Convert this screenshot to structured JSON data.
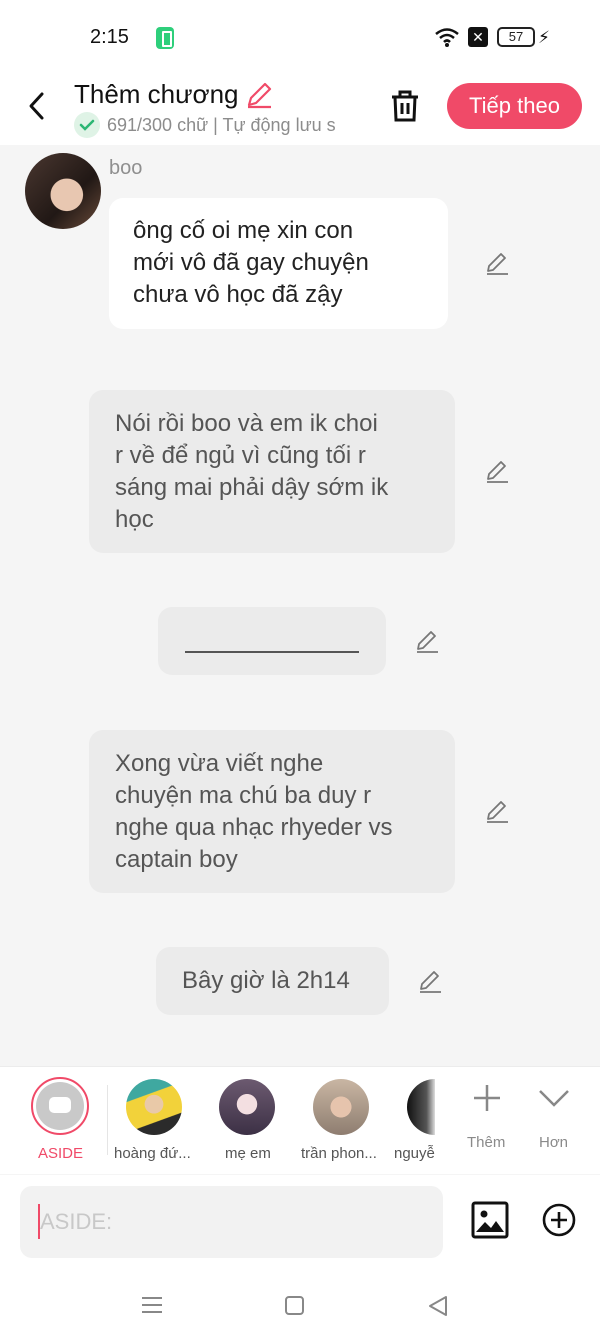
{
  "status_bar": {
    "time": "2:15",
    "battery": "57"
  },
  "header": {
    "title": "Thêm chương",
    "subtitle": "691/300 chữ | Tự động lưu s",
    "next_label": "Tiếp theo"
  },
  "author": {
    "name": "boo"
  },
  "messages": [
    {
      "lines": [
        "ông cố oi mẹ xin con",
        "mới vô đã gay chuyện",
        "chưa vô học đã zậy"
      ]
    },
    {
      "lines": [
        "Nói rồi boo và em ik choi",
        "r về để ngủ vì cũng tối r",
        "sáng mai phải dậy sớm ik",
        "học"
      ]
    },
    {
      "lines": [
        "Xong vừa viết nghe",
        "chuyện ma chú ba duy r",
        "nghe qua nhạc rhyeder vs",
        "captain boy"
      ]
    },
    {
      "lines": [
        "Bây giờ là 2h14"
      ]
    }
  ],
  "characters": {
    "aside_label": "ASIDE",
    "items": [
      {
        "label": "hoàng đứ..."
      },
      {
        "label": "mẹ em"
      },
      {
        "label": "trần phon..."
      },
      {
        "label": "nguyễ"
      }
    ],
    "more_label": "Thêm",
    "expand_label": "Hơn"
  },
  "input": {
    "placeholder": "ASIDE:"
  },
  "colors": {
    "accent": "#f04a68",
    "background": "#f5f5f5"
  }
}
